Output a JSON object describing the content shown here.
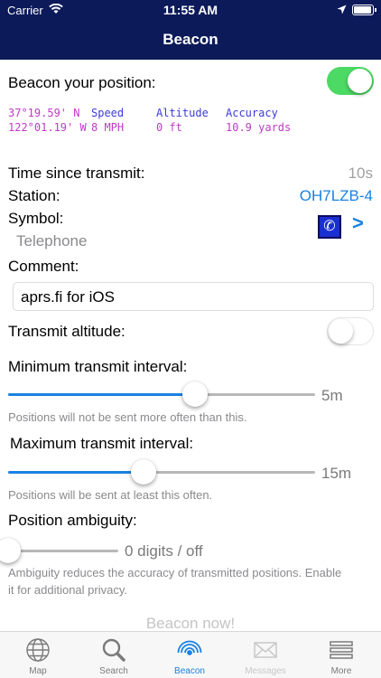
{
  "status_bar": {
    "carrier": "Carrier",
    "time": "11:55 AM"
  },
  "nav": {
    "title": "Beacon"
  },
  "beacon_position": {
    "label": "Beacon your position:",
    "enabled": true
  },
  "position_info": {
    "lat": " 37°19.59' N",
    "lon": "122°01.19' W",
    "speed_label": "Speed",
    "speed_value": "8 MPH",
    "altitude_label": "Altitude",
    "altitude_value": "0 ft",
    "accuracy_label": "Accuracy",
    "accuracy_value": "10.9 yards"
  },
  "time_since_transmit": {
    "label": "Time since transmit:",
    "value": "10s"
  },
  "station": {
    "label": "Station:",
    "value": "OH7LZB-4"
  },
  "symbol": {
    "label": "Symbol:",
    "name": "Telephone",
    "chevron": ">"
  },
  "comment": {
    "label": "Comment:",
    "value": "aprs.fi for iOS"
  },
  "transmit_altitude": {
    "label": "Transmit altitude:",
    "enabled": false
  },
  "min_interval": {
    "label": "Minimum transmit interval:",
    "value_text": "5m",
    "fraction": 0.61,
    "note": "Positions will not be sent more often than this."
  },
  "max_interval": {
    "label": "Maximum transmit interval:",
    "value_text": "15m",
    "fraction": 0.44,
    "note": "Positions will be sent at least this often."
  },
  "ambiguity": {
    "label": "Position ambiguity:",
    "value_text": "0 digits / off",
    "fraction": 0.0,
    "note_line1": "Ambiguity reduces the accuracy of transmitted positions. Enable",
    "note_line2": "it for additional privacy."
  },
  "beacon_now": {
    "label": "Beacon now!"
  },
  "tabs": [
    {
      "label": "Map",
      "icon": "globe-icon",
      "state": "normal"
    },
    {
      "label": "Search",
      "icon": "magnifier-icon",
      "state": "normal"
    },
    {
      "label": "Beacon",
      "icon": "antenna-icon",
      "state": "active"
    },
    {
      "label": "Messages",
      "icon": "envelope-icon",
      "state": "disabled"
    },
    {
      "label": "More",
      "icon": "list-icon",
      "state": "normal"
    }
  ],
  "colors": {
    "nav_bg": "#0c1a5a",
    "accent": "#1a82e2",
    "toggle_on": "#4cd964"
  }
}
